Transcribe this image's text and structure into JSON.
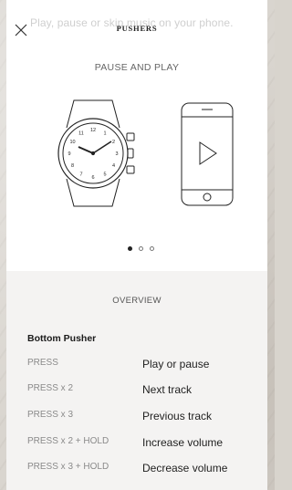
{
  "header": {
    "ghost_text": "Play, pause or skip music on your phone.",
    "brand": "PUSHERS"
  },
  "carousel": {
    "title": "PAUSE AND PLAY",
    "watch_numbers": [
      "12",
      "1",
      "2",
      "3",
      "4",
      "5",
      "6",
      "7",
      "8",
      "9",
      "10",
      "11"
    ],
    "page_count": 3,
    "active_page": 1
  },
  "overview": {
    "title": "OVERVIEW",
    "group_title": "Bottom Pusher",
    "rows": [
      {
        "action": "PRESS",
        "result": "Play or pause"
      },
      {
        "action": "PRESS x 2",
        "result": "Next track"
      },
      {
        "action": "PRESS x 3",
        "result": "Previous track"
      },
      {
        "action": "PRESS x 2 + HOLD",
        "result": "Increase volume"
      },
      {
        "action": "PRESS x 3 + HOLD",
        "result": "Decrease volume"
      }
    ]
  },
  "icons": {
    "close": "close-icon",
    "watch": "watch-illustration",
    "phone": "phone-illustration",
    "play": "play-icon"
  }
}
